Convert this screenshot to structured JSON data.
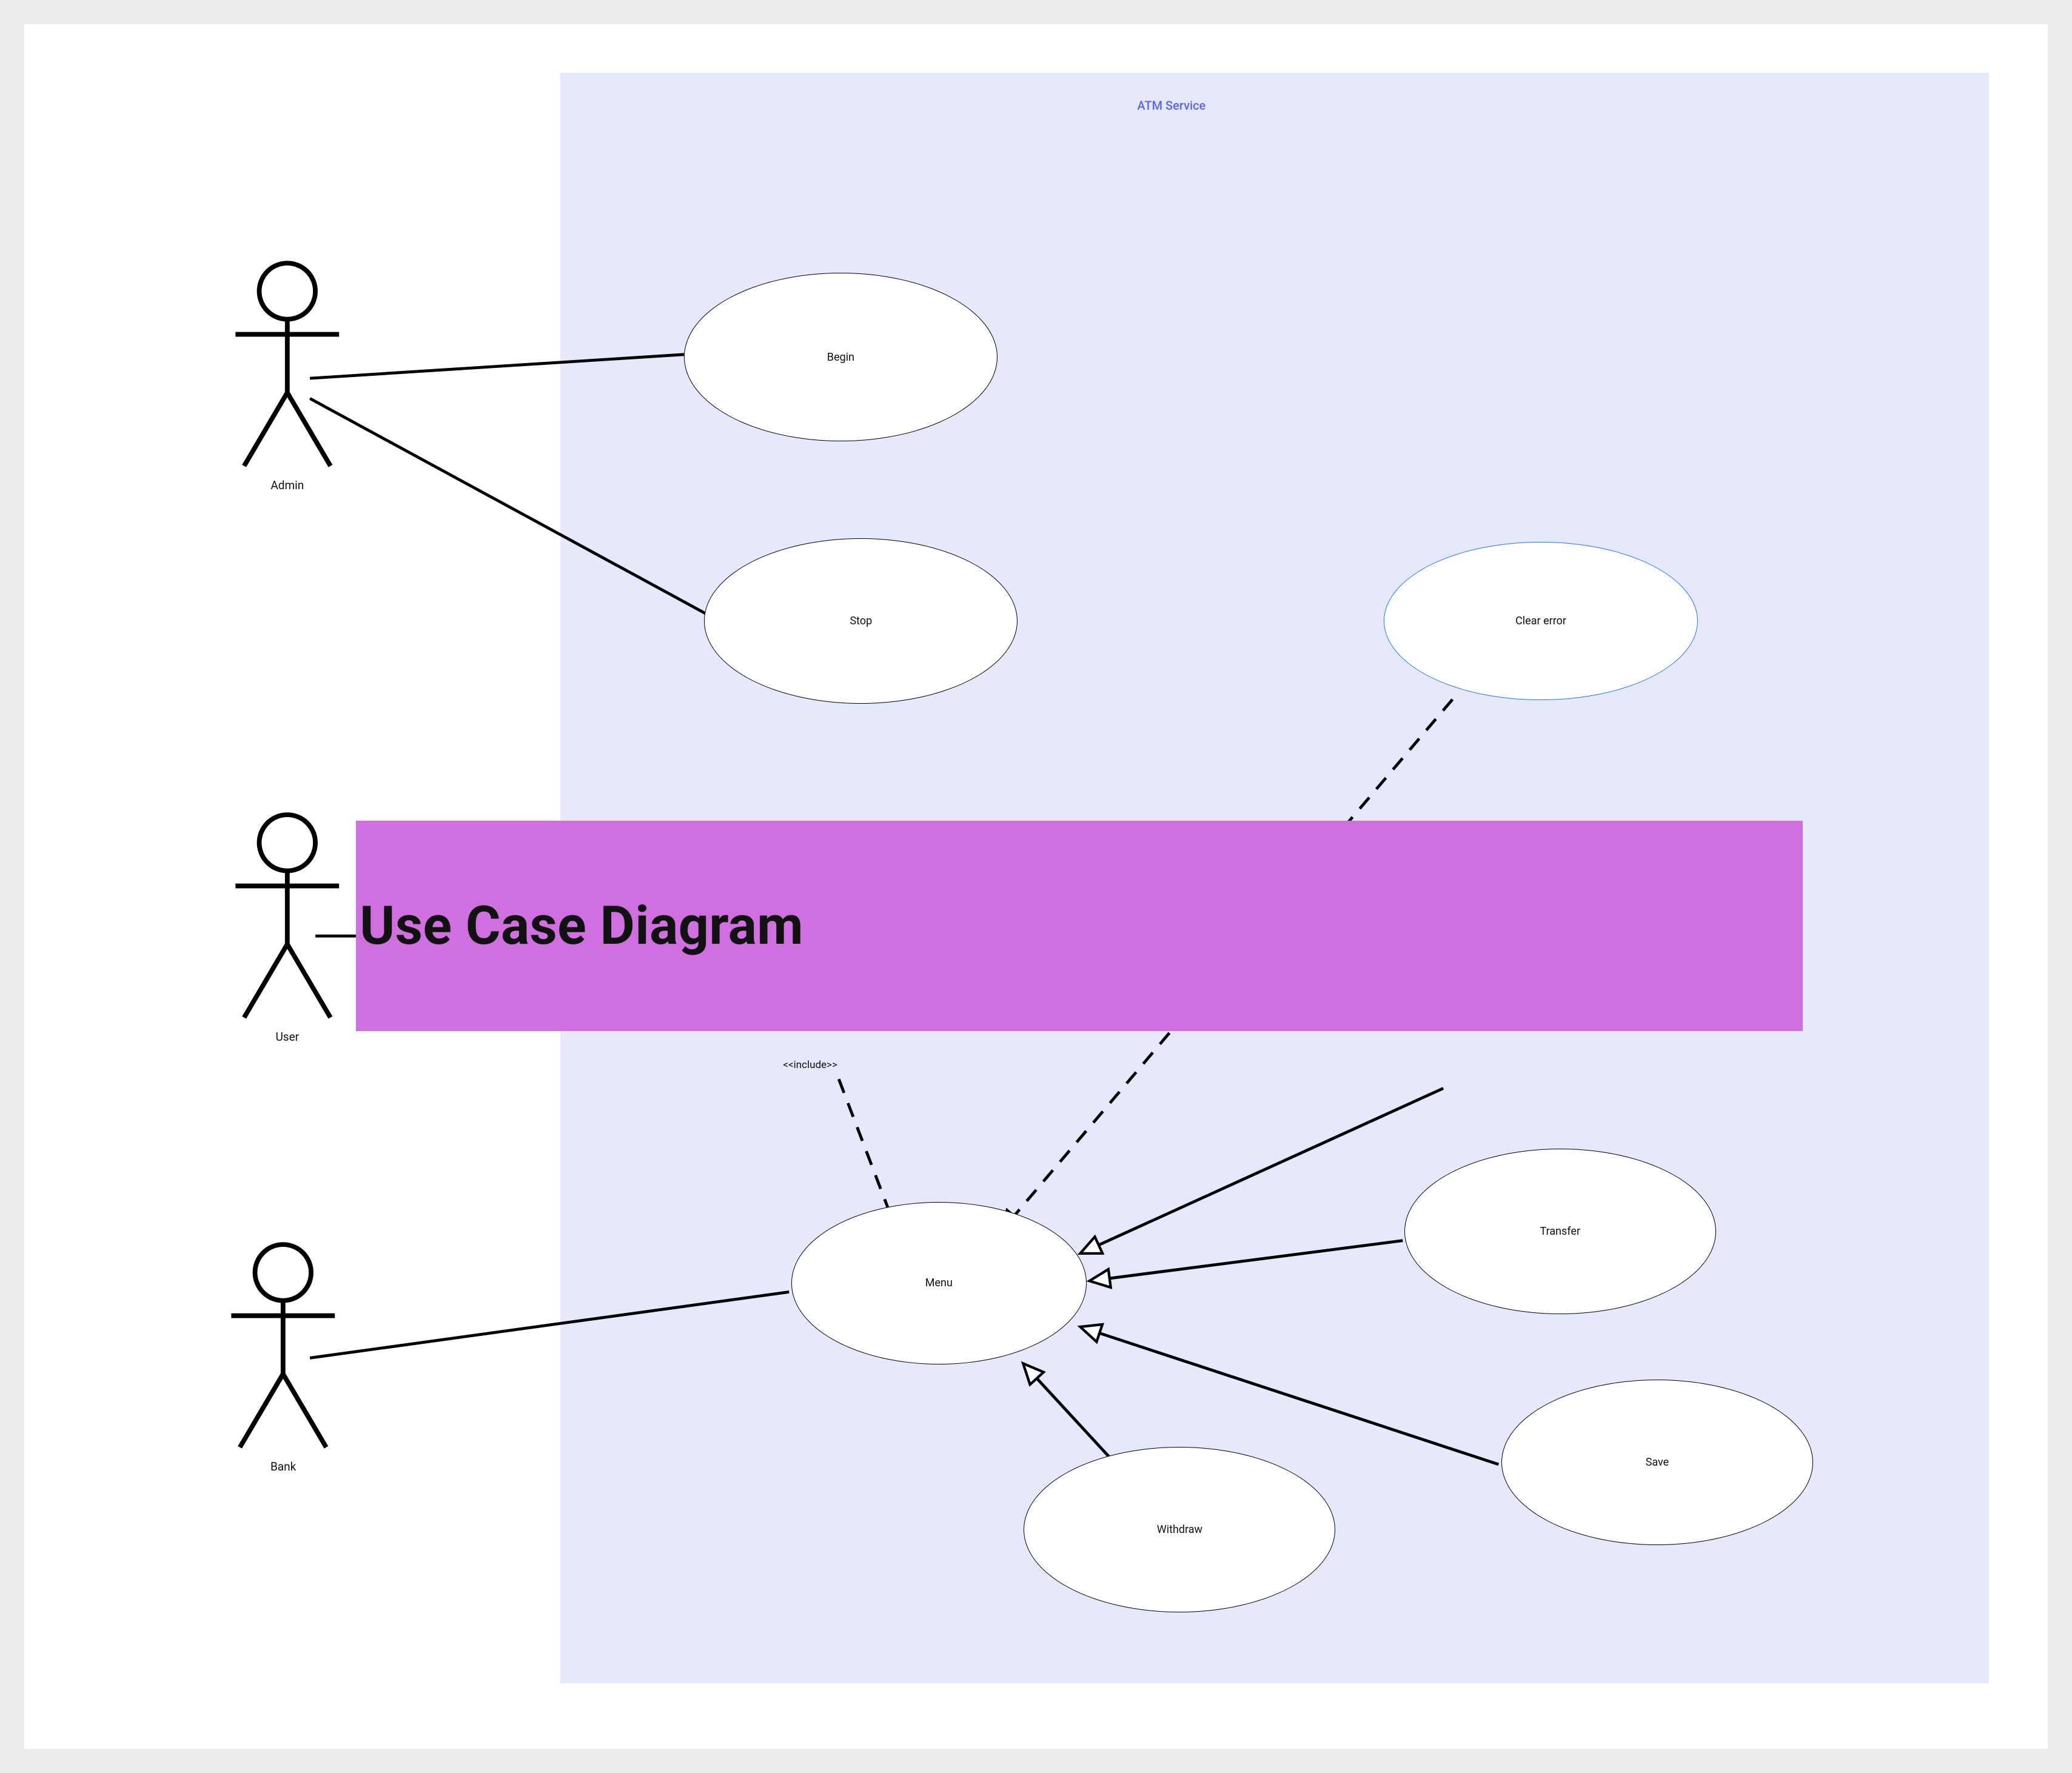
{
  "system": {
    "title": "ATM Service"
  },
  "actors": {
    "admin": {
      "label": "Admin"
    },
    "user": {
      "label": "User"
    },
    "bank": {
      "label": "Bank"
    }
  },
  "usecases": {
    "begin": {
      "label": "Begin"
    },
    "stop": {
      "label": "Stop"
    },
    "clear_error": {
      "label": "Clear error"
    },
    "menu": {
      "label": "Menu"
    },
    "transfer": {
      "label": "Transfer"
    },
    "save": {
      "label": "Save"
    },
    "withdraw": {
      "label": "Withdraw"
    }
  },
  "relations": {
    "include_label": "<<include>>"
  },
  "overlay": {
    "title": "Use Case Diagram"
  }
}
